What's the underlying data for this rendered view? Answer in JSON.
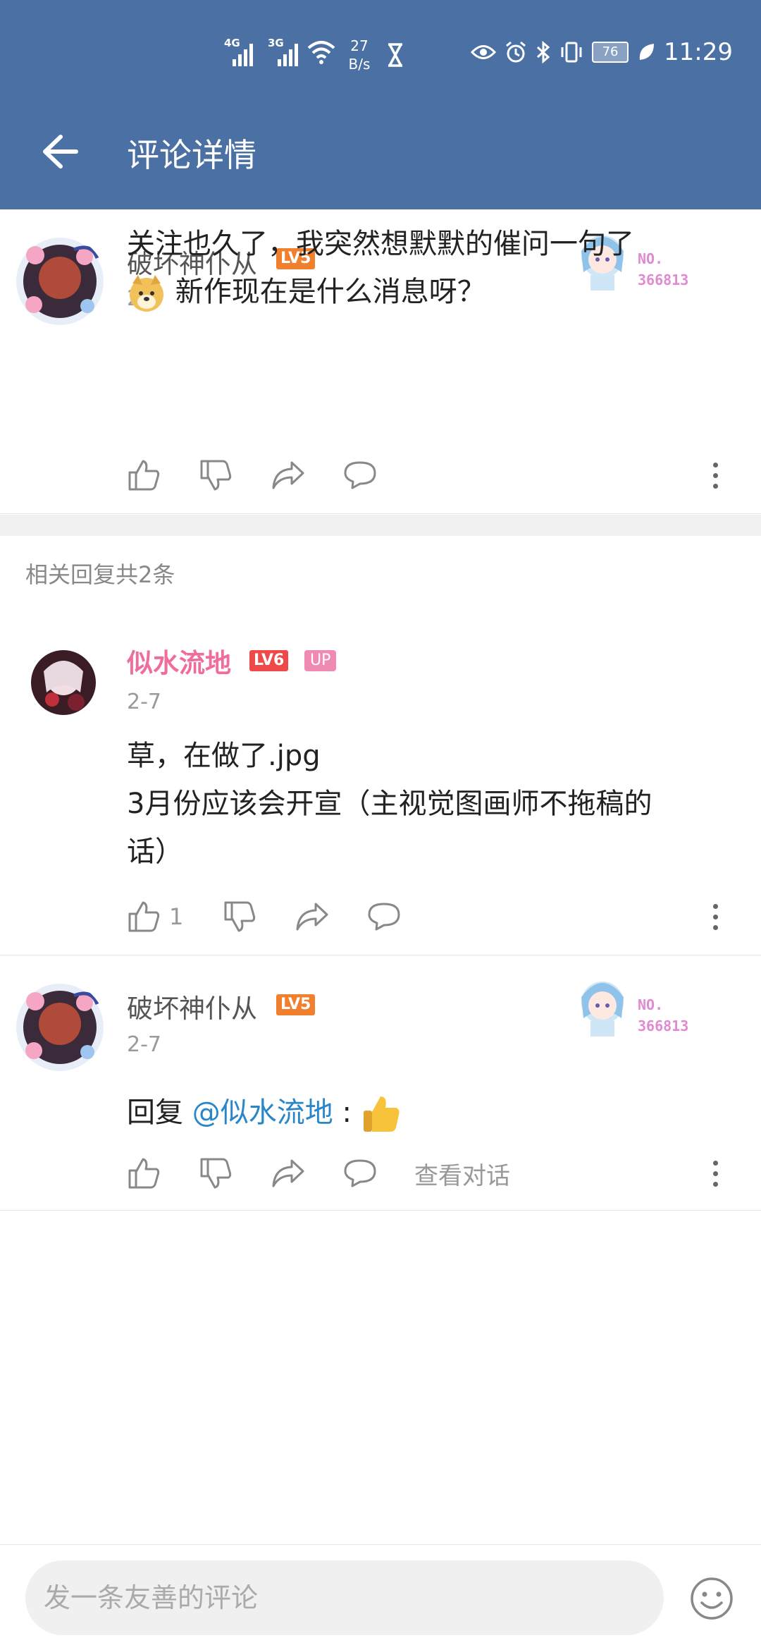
{
  "status_bar": {
    "network1": "4G",
    "network2": "3G",
    "speed_value": "27",
    "speed_unit": "B/s",
    "battery": "76",
    "time": "11:29"
  },
  "header": {
    "title": "评论详情"
  },
  "main_comment": {
    "username": "破坏神仆从",
    "level": "LV5",
    "date": "2-7",
    "text_line1": "关注也久了，我突然想默默的催问一句了",
    "text_line2": "新作现在是什么消息呀？",
    "fan_no_label": "NO.",
    "fan_no_value": "366813"
  },
  "related": {
    "label": "相关回复共2条"
  },
  "replies": [
    {
      "username": "似水流地",
      "level": "LV6",
      "badge": "UP",
      "date": "2-7",
      "text_line1": "草，在做了.jpg",
      "text_line2": "3月份应该会开宣（主视觉图画师不拖稿的",
      "text_line3": "话）",
      "like_count": "1"
    },
    {
      "username": "破坏神仆从",
      "level": "LV5",
      "date": "2-7",
      "reply_prefix": "回复",
      "mention": "@似水流地",
      "colon": ":",
      "view_conversation": "查看对话",
      "fan_no_label": "NO.",
      "fan_no_value": "366813"
    }
  ],
  "composer": {
    "placeholder": "发一条友善的评论"
  },
  "colors": {
    "header_bg": "#4a70a4",
    "lv5": "#f0802e",
    "lv6": "#ef4a4a",
    "up_badge": "#f08ab3",
    "username_pink": "#ef6d9e",
    "mention": "#2a86c8"
  }
}
